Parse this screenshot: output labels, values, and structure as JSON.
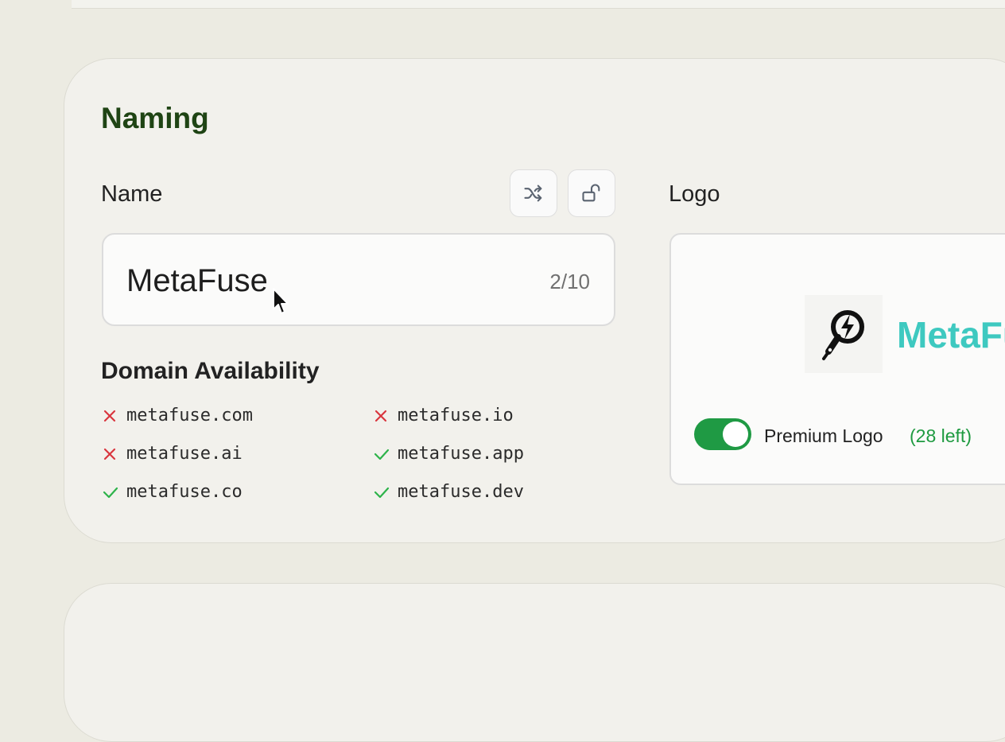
{
  "section": {
    "title": "Naming"
  },
  "name_field": {
    "label": "Name",
    "value": "MetaFuse",
    "char_count": "2/10",
    "shuffle_icon": "shuffle-icon",
    "lock_icon": "unlock-icon"
  },
  "domains": {
    "title": "Domain Availability",
    "items": [
      {
        "name": "metafuse.com",
        "available": false
      },
      {
        "name": "metafuse.io",
        "available": false
      },
      {
        "name": "metafuse.ai",
        "available": false
      },
      {
        "name": "metafuse.app",
        "available": true
      },
      {
        "name": "metafuse.co",
        "available": true
      },
      {
        "name": "metafuse.dev",
        "available": true
      }
    ]
  },
  "logo": {
    "label": "Logo",
    "brand_text": "MetaFuse",
    "premium_label": "Premium Logo",
    "premium_count": "(28 left)",
    "premium_enabled": true
  },
  "colors": {
    "title_green": "#1f4414",
    "available_green": "#2db34a",
    "unavailable_red": "#d9363e",
    "toggle_green": "#1f9a44",
    "brand_teal": "#3ec9c0"
  }
}
